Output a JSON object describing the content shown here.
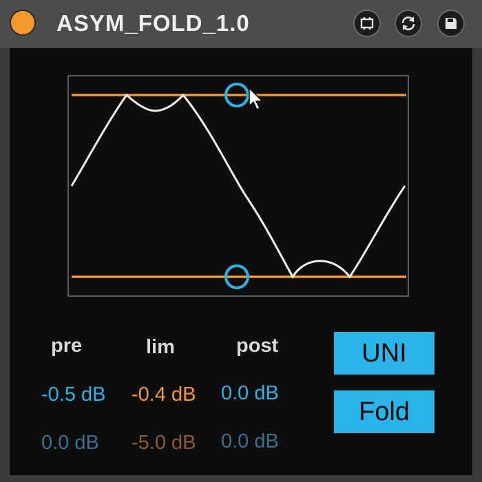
{
  "device": {
    "title": "ASYM_FOLD_1.0",
    "power_on": true,
    "icons": [
      "power-toggle-icon",
      "freeze-device-icon",
      "hot-swap-icon",
      "save-preset-icon"
    ]
  },
  "colors": {
    "accent_orange": "#f7992a",
    "accent_blue": "#29b4ea",
    "waveform": "#f0f0f0",
    "panel_bg": "#0d0d0d",
    "pre_dim": "#3a6f8f",
    "lim_dim": "#8a5d2e",
    "post_dim": "#3a6f8f"
  },
  "params": {
    "pre": {
      "label": "pre",
      "value": "-0.5 dB",
      "secondary": "0.0 dB"
    },
    "lim": {
      "label": "lim",
      "value": "-0.4 dB",
      "secondary": "-5.0 dB"
    },
    "post": {
      "label": "post",
      "value": "0.0 dB",
      "secondary": "0.0 dB"
    }
  },
  "buttons": {
    "uni": "UNI",
    "fold": "Fold"
  },
  "display": {
    "upper_threshold": 0.85,
    "lower_threshold": -0.85,
    "upper_handle_position": 0.5,
    "lower_handle_position": 0.5
  }
}
